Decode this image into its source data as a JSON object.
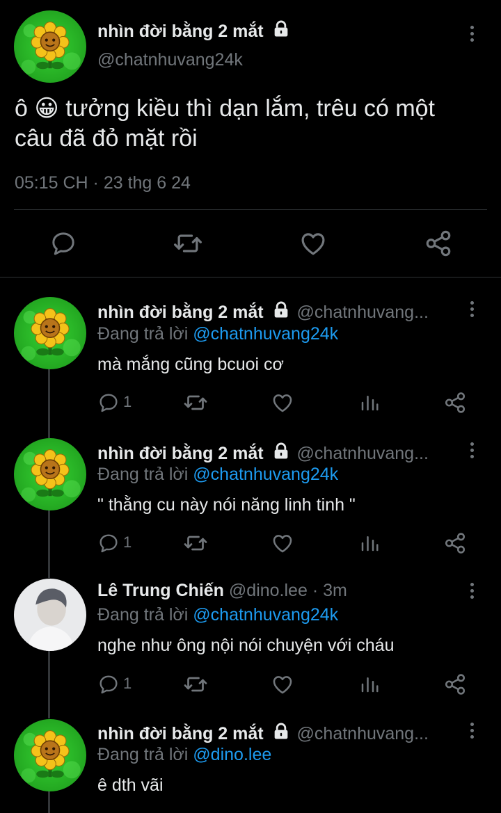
{
  "main_tweet": {
    "display_name": "nhìn đời bằng 2 mắt",
    "handle": "@chatnhuvang24k",
    "text_line1": "ô 😀 tưởng kiều thì dạn lắm, trêu có một",
    "text_line2": "câu đã đỏ mặt rồi",
    "timestamp": "05:15 CH · 23 thg 6 24"
  },
  "replies": [
    {
      "display_name": "nhìn đời bằng 2 mắt",
      "handle": "@chatnhuvang...",
      "meta": "",
      "reply_prefix": "Đang trả lời",
      "reply_to": "@chatnhuvang24k",
      "text": "mà mắng cũng bcuoi cơ",
      "reply_count": "1"
    },
    {
      "display_name": "nhìn đời bằng 2 mắt",
      "handle": "@chatnhuvang...",
      "meta": "",
      "reply_prefix": "Đang trả lời",
      "reply_to": "@chatnhuvang24k",
      "text": "\" thằng cu này nói năng linh tinh \"",
      "reply_count": "1"
    },
    {
      "display_name": "Lê Trung Chiến",
      "handle": "@dino.lee",
      "meta": "· 3m",
      "reply_prefix": "Đang trả lời",
      "reply_to": "@chatnhuvang24k",
      "text": "nghe như ông nội nói chuyện với cháu",
      "reply_count": "1"
    },
    {
      "display_name": "nhìn đời bằng 2 mắt",
      "handle": "@chatnhuvang...",
      "meta": "",
      "reply_prefix": "Đang trả lời",
      "reply_to": "@dino.lee",
      "text": "ê dth vãi",
      "reply_count": ""
    }
  ],
  "icons": {
    "reply": "reply-icon",
    "retweet": "retweet-icon",
    "like": "like-icon",
    "views": "views-icon",
    "share": "share-icon",
    "lock": "lock-icon",
    "more": "more-icon"
  },
  "colors": {
    "background": "#000000",
    "text": "#e7e9ea",
    "muted": "#71767b",
    "link": "#1d9bf0",
    "divider": "#2f3336",
    "avatar_green": "#2fc52b"
  }
}
